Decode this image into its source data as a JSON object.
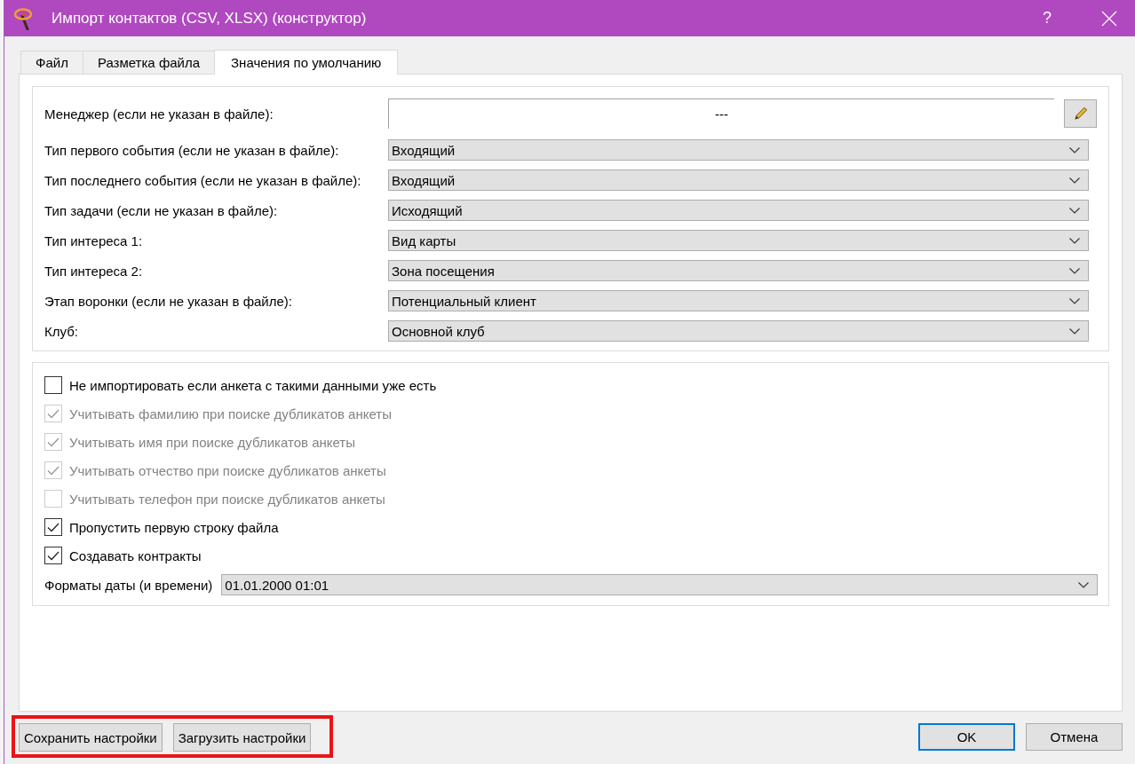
{
  "window": {
    "title": "Импорт контактов (CSV, XLSX) (конструктор)",
    "help_button": "?"
  },
  "tabs": [
    {
      "label": "Файл",
      "selected": false
    },
    {
      "label": "Разметка файла",
      "selected": false
    },
    {
      "label": "Значения по умолчанию",
      "selected": true
    }
  ],
  "manager": {
    "label": "Менеджер (если не указан в файле):",
    "value": "---"
  },
  "default_fields": [
    {
      "label": "Тип первого события (если не указан в файле):",
      "value": "Входящий"
    },
    {
      "label": "Тип последнего события (если не указан в файле):",
      "value": "Входящий"
    },
    {
      "label": "Тип задачи (если не указан в файле):",
      "value": "Исходящий"
    },
    {
      "label": "Тип интереса 1:",
      "value": "Вид карты"
    },
    {
      "label": "Тип интереса 2:",
      "value": "Зона посещения"
    },
    {
      "label": "Этап воронки (если не указан в файле):",
      "value": "Потенциальный клиент"
    },
    {
      "label": "Клуб:",
      "value": "Основной клуб"
    }
  ],
  "options": [
    {
      "label": "Не импортировать если анкета с такими данными уже есть",
      "checked": false,
      "disabled": false
    },
    {
      "label": "Учитывать фамилию при поиске дубликатов анкеты",
      "checked": true,
      "disabled": true
    },
    {
      "label": "Учитывать имя при поиске дубликатов анкеты",
      "checked": true,
      "disabled": true
    },
    {
      "label": "Учитывать отчество при поиске дубликатов анкеты",
      "checked": true,
      "disabled": true
    },
    {
      "label": "Учитывать телефон при поиске дубликатов анкеты",
      "checked": false,
      "disabled": true
    },
    {
      "label": "Пропустить первую строку файла",
      "checked": true,
      "disabled": false
    },
    {
      "label": "Создавать контракты",
      "checked": true,
      "disabled": false
    }
  ],
  "date_format": {
    "label": "Форматы даты (и времени)",
    "value": "01.01.2000 01:01"
  },
  "settings_buttons": {
    "highlighted": true,
    "items": [
      "Сохранить настройки",
      "Загрузить настройки"
    ]
  },
  "dialog_buttons": [
    {
      "label": "OK",
      "default": true
    },
    {
      "label": "Отмена",
      "default": false
    }
  ]
}
